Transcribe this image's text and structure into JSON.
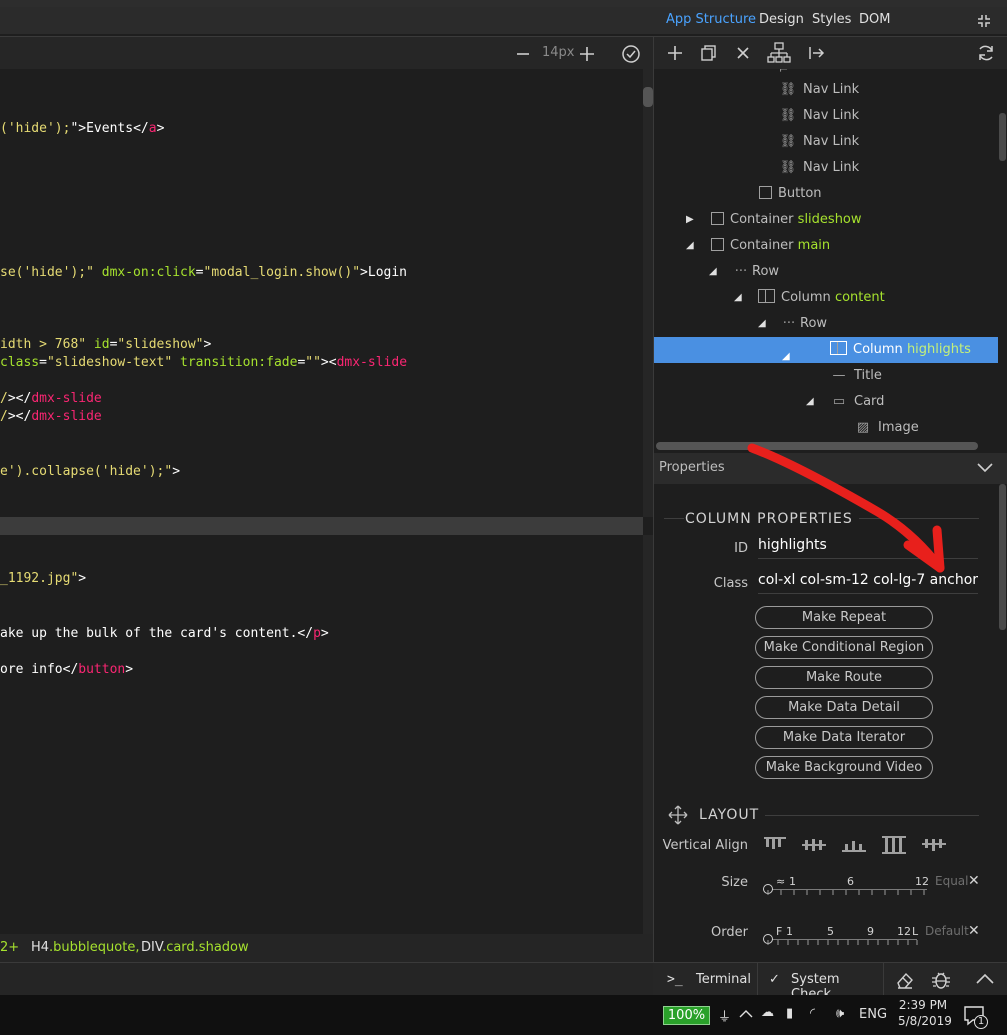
{
  "menubar": {
    "tabs": [
      "App Structure",
      "Design",
      "Styles",
      "DOM"
    ],
    "active_tab": "App Structure",
    "collapse_icon": "collapse-arrows-icon"
  },
  "editor_toolbar": {
    "zoom_out_icon": "minus-icon",
    "font_size": "14px",
    "zoom_in_icon": "plus-icon",
    "validate_icon": "check-circle-icon"
  },
  "code_top": [
    {
      "parts": [
        [
          "s",
          "('hide');"
        ],
        [
          "w",
          "\">Events</"
        ],
        [
          "t",
          "a"
        ],
        [
          "w",
          ">"
        ]
      ]
    },
    {
      "parts": [
        [
          "s",
          "se('hide');\" "
        ],
        [
          "a",
          "dmx-on:click"
        ],
        [
          "w",
          "="
        ],
        [
          "s",
          "\"modal_login.show()\""
        ],
        [
          "w",
          ">Login"
        ]
      ]
    },
    {
      "parts": [
        [
          "s",
          "idth > 768\" "
        ],
        [
          "a",
          "id"
        ],
        [
          "w",
          "="
        ],
        [
          "s",
          "\"slideshow\""
        ],
        [
          "w",
          ">"
        ]
      ]
    },
    {
      "parts": [
        [
          "a",
          "class"
        ],
        [
          "w",
          "="
        ],
        [
          "s",
          "\"slideshow-text\" "
        ],
        [
          "a",
          "transition:fade"
        ],
        [
          "w",
          "="
        ],
        [
          "s",
          "\"\""
        ],
        [
          "w",
          "><"
        ],
        [
          "t",
          "dmx-slide"
        ]
      ]
    },
    {
      "parts": [
        [
          "s",
          "/"
        ],
        [
          "w",
          "></"
        ],
        [
          "t",
          "dmx-slide"
        ]
      ]
    },
    {
      "parts": [
        [
          "s",
          "/"
        ],
        [
          "w",
          "></"
        ],
        [
          "t",
          "dmx-slide"
        ]
      ]
    },
    {
      "parts": [
        [
          "s",
          "e').collapse('hide');\""
        ],
        [
          "w",
          ">"
        ]
      ]
    }
  ],
  "code_bottom": [
    {
      "parts": [
        [
          "s",
          "_1192.jpg\""
        ],
        [
          "w",
          ">"
        ]
      ]
    },
    {
      "parts": [
        [
          "w",
          "ake up the bulk of the card's content.</"
        ],
        [
          "t",
          "p"
        ],
        [
          "w",
          ">"
        ]
      ]
    },
    {
      "parts": [
        [
          "w",
          "ore info</"
        ],
        [
          "t",
          "button"
        ],
        [
          "w",
          ">"
        ]
      ]
    }
  ],
  "breadcrumb": {
    "items": [
      {
        "tag": "2+",
        "cls": ""
      },
      {
        "tag": "H4",
        "cls": ".bubblequote,"
      },
      {
        "tag": "DIV",
        "cls": ".card.shadow"
      }
    ]
  },
  "right_toolbar": {
    "icons": [
      "add-icon",
      "duplicate-icon",
      "delete-icon",
      "hierarchy-icon",
      "move-out-icon",
      "refresh-icon"
    ]
  },
  "tree": {
    "nodes": [
      {
        "label": "Nav Link",
        "suffix": "",
        "icon": "link-icon",
        "indent": 2
      },
      {
        "label": "Nav Link",
        "suffix": "",
        "icon": "link-icon",
        "indent": 2
      },
      {
        "label": "Nav Link",
        "suffix": "",
        "icon": "link-icon",
        "indent": 2
      },
      {
        "label": "Nav Link",
        "suffix": "",
        "icon": "link-icon",
        "indent": 2
      },
      {
        "label": "Button",
        "suffix": "",
        "icon": "box-icon",
        "indent": 1
      },
      {
        "label": "Container",
        "suffix": "slideshow",
        "icon": "box-icon",
        "indent": 0,
        "twist": "collapsed"
      },
      {
        "label": "Container",
        "suffix": "main",
        "icon": "box-icon",
        "indent": 0,
        "twist": "expanded"
      },
      {
        "label": "Row",
        "suffix": "",
        "icon": "dots-icon",
        "indent": 1,
        "twist": "expanded"
      },
      {
        "label": "Column",
        "suffix": "content",
        "icon": "column-icon",
        "indent": 2,
        "twist": "expanded"
      },
      {
        "label": "Row",
        "suffix": "",
        "icon": "dots-icon",
        "indent": 3,
        "twist": "expanded"
      },
      {
        "label": "Column",
        "suffix": "highlights",
        "icon": "column-icon",
        "indent": 4,
        "twist": "expanded",
        "selected": true
      },
      {
        "label": "Title",
        "suffix": "",
        "icon": "dash-icon",
        "indent": 5
      },
      {
        "label": "Card",
        "suffix": "",
        "icon": "card-icon",
        "indent": 5,
        "twist": "expanded"
      },
      {
        "label": "Image",
        "suffix": "",
        "icon": "image-icon",
        "indent": 6
      }
    ]
  },
  "properties": {
    "header": "Properties",
    "section_title": "COLUMN PROPERTIES",
    "id_label": "ID",
    "id_value": "highlights",
    "class_label": "Class",
    "class_value": "col-xl col-sm-12 col-lg-7 anchor",
    "buttons": [
      "Make Repeat",
      "Make Conditional Region",
      "Make Route",
      "Make Data Detail",
      "Make Data Iterator",
      "Make Background Video"
    ],
    "layout_title": "LAYOUT",
    "vertical_align_label": "Vertical Align",
    "size_label": "Size",
    "size_ticks": [
      "≈",
      "1",
      "6",
      "12"
    ],
    "size_end": "Equal",
    "order_label": "Order",
    "order_ticks": [
      "F",
      "1",
      "5",
      "9",
      "12",
      "L"
    ],
    "order_end": "Default"
  },
  "statusbar": {
    "terminal": "Terminal",
    "system_check": "System Check"
  },
  "taskbar": {
    "battery": "100%",
    "language": "ENG",
    "time": "2:39 PM",
    "date": "5/8/2019",
    "notifications": "1"
  },
  "colors": {
    "accent_blue": "#4a90e2",
    "tab_active": "#4aa3ff",
    "annotation_red": "#e8201c",
    "class_green": "#a6e22e"
  }
}
